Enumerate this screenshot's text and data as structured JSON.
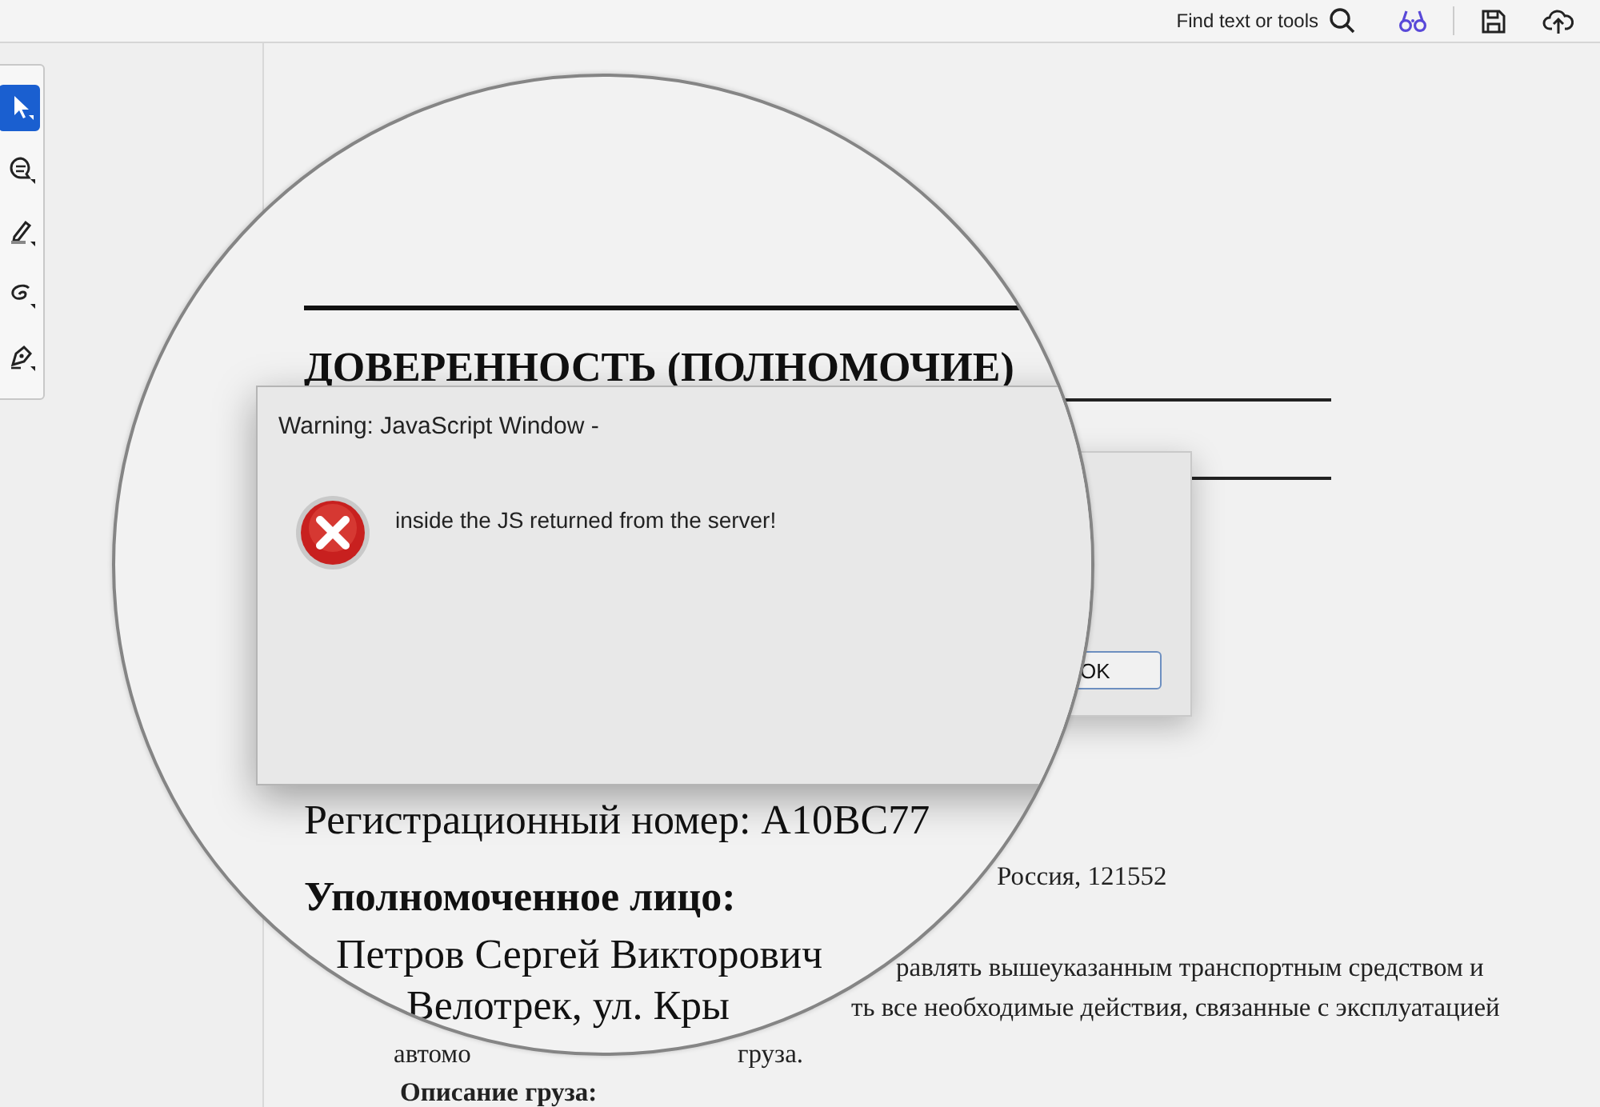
{
  "toolbar": {
    "search_label": "Find text or tools"
  },
  "tools": [
    {
      "kind": "select",
      "selected": true
    },
    {
      "kind": "comment",
      "selected": false
    },
    {
      "kind": "highlight",
      "selected": false
    },
    {
      "kind": "draw",
      "selected": false
    },
    {
      "kind": "sign",
      "selected": false
    }
  ],
  "document": {
    "fragments": [
      {
        "text": "Россия, 121552",
        "bold": false
      },
      {
        "text": "равлять вышеуказанным транспортным средством и",
        "bold": false
      },
      {
        "text": "ть все необходимые действия, связанные с эксплуатацией",
        "bold": false
      },
      {
        "text": "автомо",
        "bold": false
      },
      {
        "text": "груза.",
        "bold": false
      },
      {
        "text": "Описание груза:",
        "bold": true
      }
    ]
  },
  "background_dialog": {
    "button": "OK"
  },
  "magnifier": {
    "heading": "ДОВЕРЕННОСТЬ (ПОЛНОМОЧИЕ)",
    "lines": [
      {
        "text": "Регистрационный номер: A10BC77",
        "bold": false
      },
      {
        "text": "Уполномоченное лицо:",
        "bold": true
      },
      {
        "text": "Петров Сергей Викторович",
        "bold": false
      },
      {
        "text": "Велотрек, ул. Кры",
        "bold": false
      }
    ],
    "dialog": {
      "title": "Warning: JavaScript Window -",
      "message": "inside the JS returned from the server!"
    }
  }
}
